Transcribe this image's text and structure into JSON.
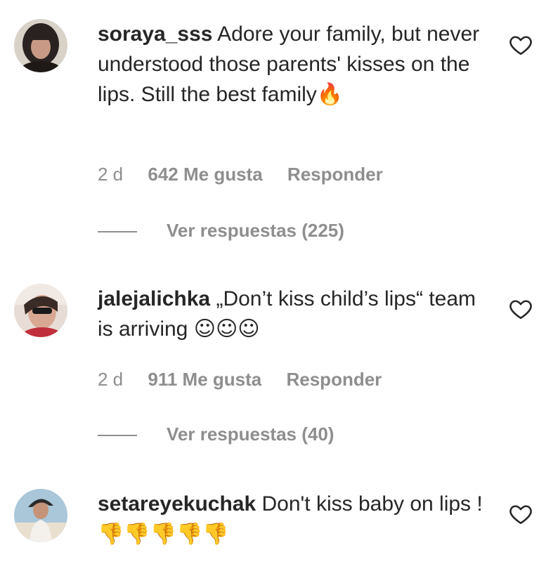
{
  "comments": [
    {
      "username": "soraya_sss",
      "text": "Adore your family, but never understood those parents' kisses on the lips. Still the best family",
      "emoji": "🔥",
      "time": "2 d",
      "likes": "642 Me gusta",
      "reply": "Responder",
      "view_replies": "Ver respuestas (225)"
    },
    {
      "username": "jalejalichka",
      "text": "„Don’t kiss child’s lips“ team is arriving",
      "emoji": "☺☺☺",
      "time": "2 d",
      "likes": "911 Me gusta",
      "reply": "Responder",
      "view_replies": "Ver respuestas (40)"
    },
    {
      "username": "setareyekuchak",
      "text": "Don't kiss baby on lips !",
      "emoji": "👎👎👎👎👎"
    }
  ],
  "colors": {
    "text": "#262626",
    "muted": "#8e8e8e",
    "background": "#ffffff"
  }
}
